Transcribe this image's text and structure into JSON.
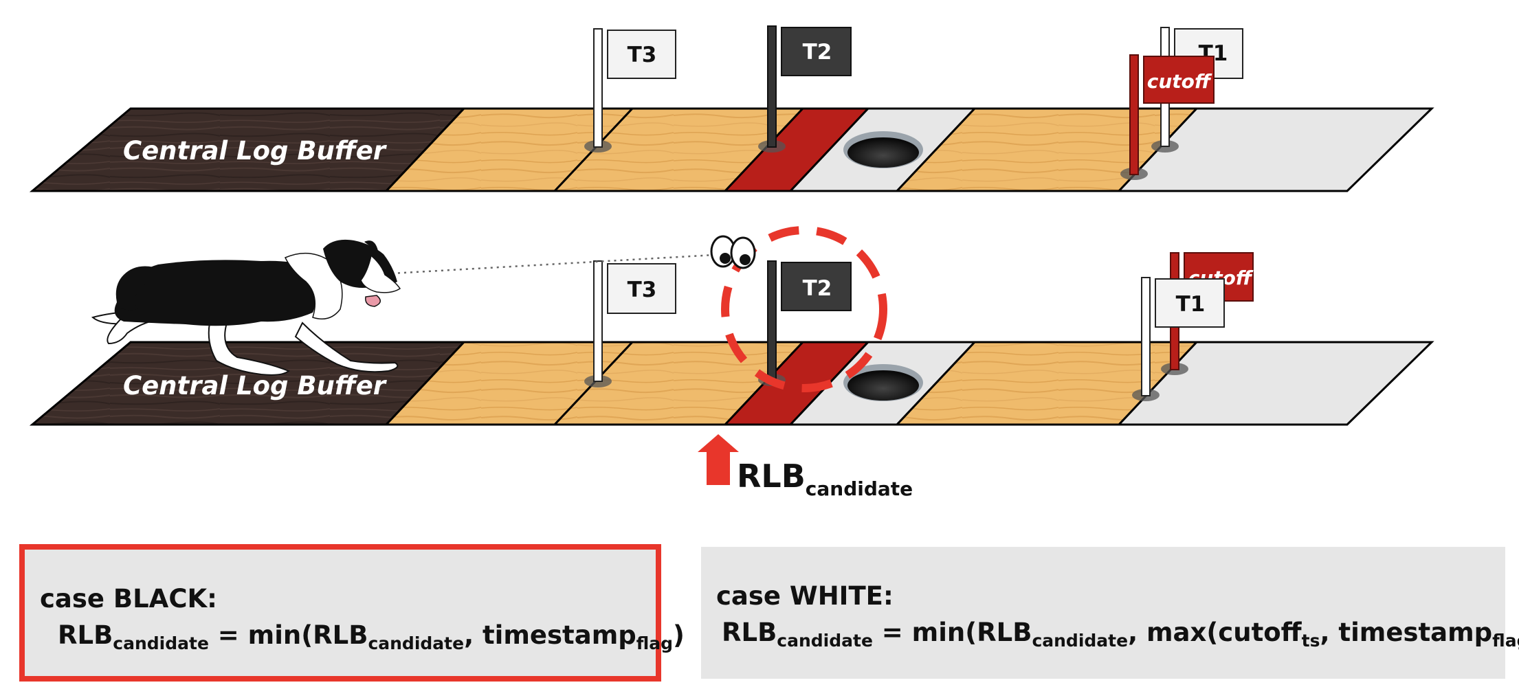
{
  "colors": {
    "dark_wood": "#3a2b27",
    "light_wood": "#efbb6c",
    "red_slot": "#b81f1a",
    "empty_slot": "#e7e7e7",
    "accent_red": "#e8362b",
    "box_bg": "#e6e6e6"
  },
  "tracks": [
    {
      "buffer_label": "Central Log Buffer",
      "flags": {
        "t3": "T3",
        "t2": "T2",
        "t1": "T1",
        "cutoff": "cutoff"
      }
    },
    {
      "buffer_label": "Central Log Buffer",
      "flags": {
        "t3": "T3",
        "t2": "T2",
        "t1": "T1",
        "cutoff": "cutoff"
      }
    }
  ],
  "pointer": {
    "main": "RLB",
    "sub": "candidate"
  },
  "cases": {
    "black": {
      "title": "case BLACK:",
      "f": [
        "RLB",
        "candidate",
        " = min(RLB",
        "candidate",
        ", timestamp",
        "flag",
        ")"
      ]
    },
    "white": {
      "title": "case WHITE:",
      "f": [
        "RLB",
        "candidate",
        " = min(RLB",
        "candidate",
        ", max(cutoff",
        "ts",
        ", timestamp",
        "flag",
        "))"
      ]
    }
  }
}
